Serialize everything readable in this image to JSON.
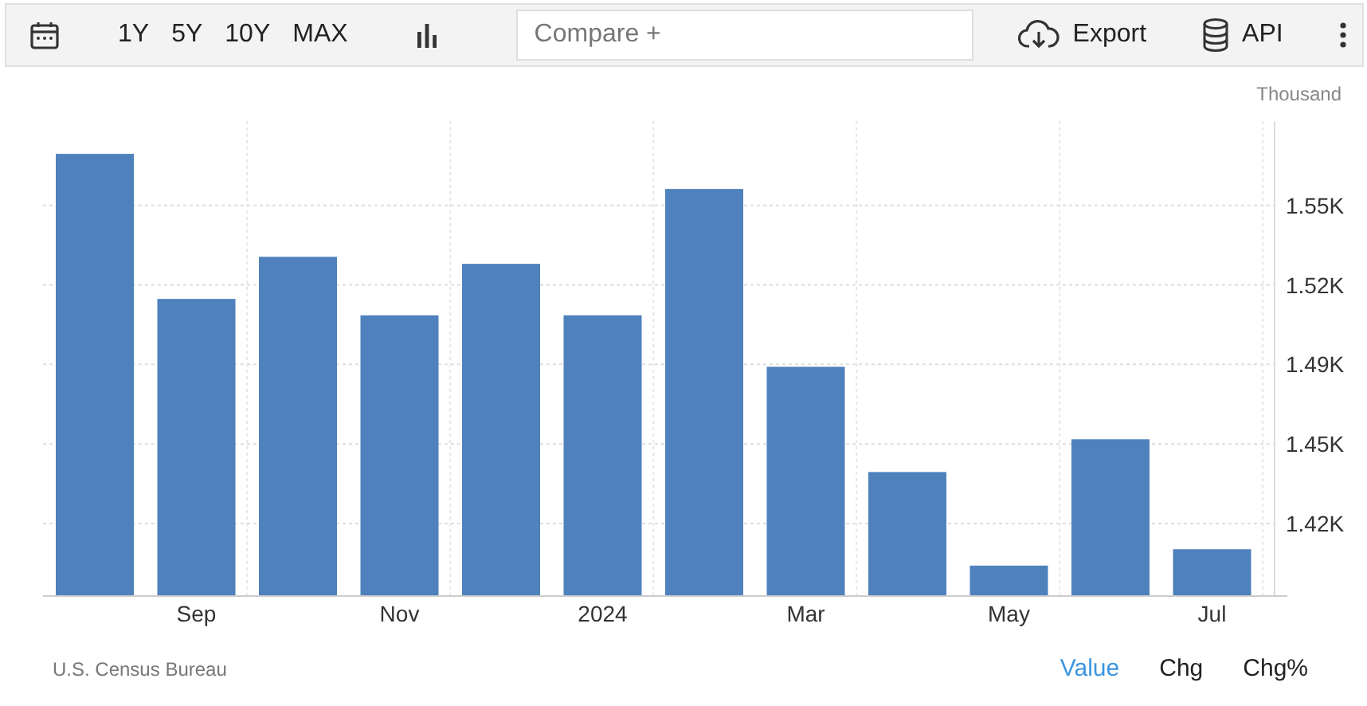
{
  "toolbar": {
    "ranges": [
      "1Y",
      "5Y",
      "10Y",
      "MAX"
    ],
    "compare": {
      "placeholder": "Compare +"
    },
    "export": "Export",
    "api": "API"
  },
  "chart": {
    "unit": "Thousand",
    "chart_data": {
      "type": "bar",
      "categories": [
        null,
        "Sep",
        null,
        "Nov",
        null,
        "2024",
        null,
        "Mar",
        null,
        "May",
        null,
        "Jul"
      ],
      "series": [
        {
          "color": "#4f81bd",
          "values": [
            1.576,
            1.514,
            1.532,
            1.507,
            1.529,
            1.507,
            1.561,
            1.485,
            1.44,
            1.4,
            1.454,
            1.407
          ]
        }
      ],
      "ylim": [
        1.387,
        1.59
      ],
      "grid": true,
      "yticks": [
        {
          "value": 1.554,
          "label": "1.55K"
        },
        {
          "value": 1.52,
          "label": "1.52K"
        },
        {
          "value": 1.486,
          "label": "1.49K"
        },
        {
          "value": 1.452,
          "label": "1.45K"
        },
        {
          "value": 1.418,
          "label": "1.42K"
        }
      ]
    }
  },
  "footer": {
    "source": "U.S. Census Bureau",
    "modes": [
      {
        "label": "Value",
        "selected": true
      },
      {
        "label": "Chg",
        "selected": false
      },
      {
        "label": "Chg%",
        "selected": false
      }
    ]
  }
}
